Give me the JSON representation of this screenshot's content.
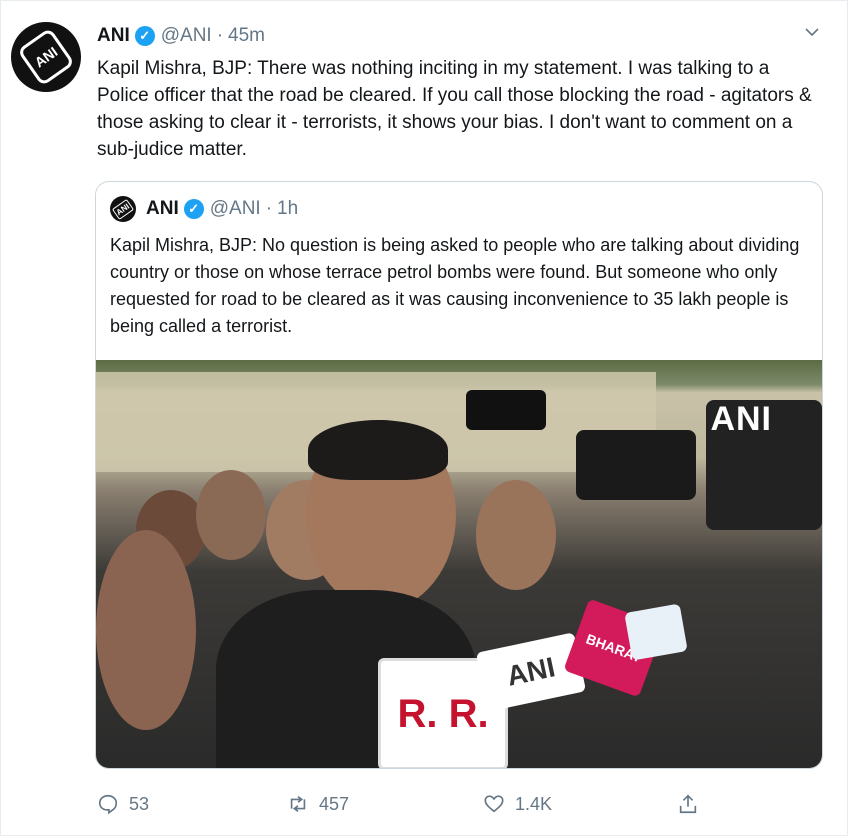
{
  "tweet": {
    "name": "ANI",
    "handle": "@ANI",
    "separator": "·",
    "time": "45m",
    "text": "Kapil Mishra, BJP: There was nothing inciting in my statement. I was talking to a Police officer that the road be cleared. If you call those blocking the road - agitators & those asking to clear it - terrorists, it shows your bias. I don't want to comment on a sub-judice matter.",
    "avatar_text": "ANI",
    "verified_icon": "verified-badge-icon",
    "menu_icon": "chevron-down-icon"
  },
  "quote": {
    "name": "ANI",
    "handle": "@ANI",
    "separator": "·",
    "time": "1h",
    "text": "Kapil Mishra, BJP: No question is being asked to people who are talking about dividing country or those on whose terrace petrol bombs were found. But someone who only requested for road to be cleared as it was causing inconvenience to 35 lakh people is being called a terrorist.",
    "image": {
      "watermark": "ANI",
      "mic_labels": [
        "R.",
        "R.",
        "ANI",
        "BHARAT"
      ]
    }
  },
  "actions": {
    "reply_count": "53",
    "retweet_count": "457",
    "like_count": "1.4K",
    "share_label": ""
  },
  "colors": {
    "accent": "#1da1f2",
    "secondary_text": "#657786",
    "border": "#ccd6dd"
  }
}
